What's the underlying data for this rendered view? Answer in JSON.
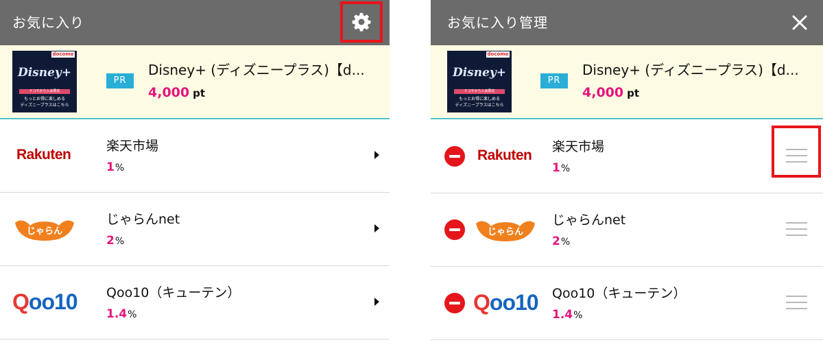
{
  "left": {
    "header": {
      "title": "お気に入り",
      "settings_icon": "gear-icon"
    },
    "pr_item": {
      "badge": "PR",
      "title": "Disney+ (ディズニープラス)【d...",
      "points": "4,000",
      "points_unit": "pt",
      "thumb": {
        "brand": "docomo",
        "logo": "Disney+",
        "band": "ドコモから入会限定",
        "caption_line1": "もっとお得に楽しめる",
        "caption_line2": "ディズニープラスはこちら"
      }
    },
    "items": [
      {
        "name": "楽天市場",
        "rate": "1",
        "unit": "%",
        "logo": "Rakuten"
      },
      {
        "name": "じゃらんnet",
        "rate": "2",
        "unit": "%",
        "logo": "じゃらん"
      },
      {
        "name": "Qoo10（キューテン）",
        "rate": "1.4",
        "unit": "%",
        "logo_q": "Q",
        "logo_rest": "oo10"
      }
    ]
  },
  "right": {
    "header": {
      "title": "お気に入り管理",
      "close_icon": "close-icon"
    },
    "pr_item": {
      "badge": "PR",
      "title": "Disney+ (ディズニープラス)【d...",
      "points": "4,000",
      "points_unit": "pt",
      "thumb": {
        "brand": "docomo",
        "logo": "Disney+",
        "band": "ドコモから入会限定",
        "caption_line1": "もっとお得に楽しめる",
        "caption_line2": "ディズニープラスはこちら"
      }
    },
    "items": [
      {
        "name": "楽天市場",
        "rate": "1",
        "unit": "%",
        "logo": "Rakuten"
      },
      {
        "name": "じゃらんnet",
        "rate": "2",
        "unit": "%",
        "logo": "じゃらん"
      },
      {
        "name": "Qoo10（キューテン）",
        "rate": "1.4",
        "unit": "%",
        "logo_q": "Q",
        "logo_rest": "oo10"
      }
    ]
  },
  "colors": {
    "header": "#6b6b6b",
    "accent": "#e4157c",
    "highlight": "#e8141b",
    "pr_badge": "#2aaed7",
    "pr_bg": "#fdfbe3",
    "divider": "#4fc3c9",
    "delete": "#e4161c"
  }
}
